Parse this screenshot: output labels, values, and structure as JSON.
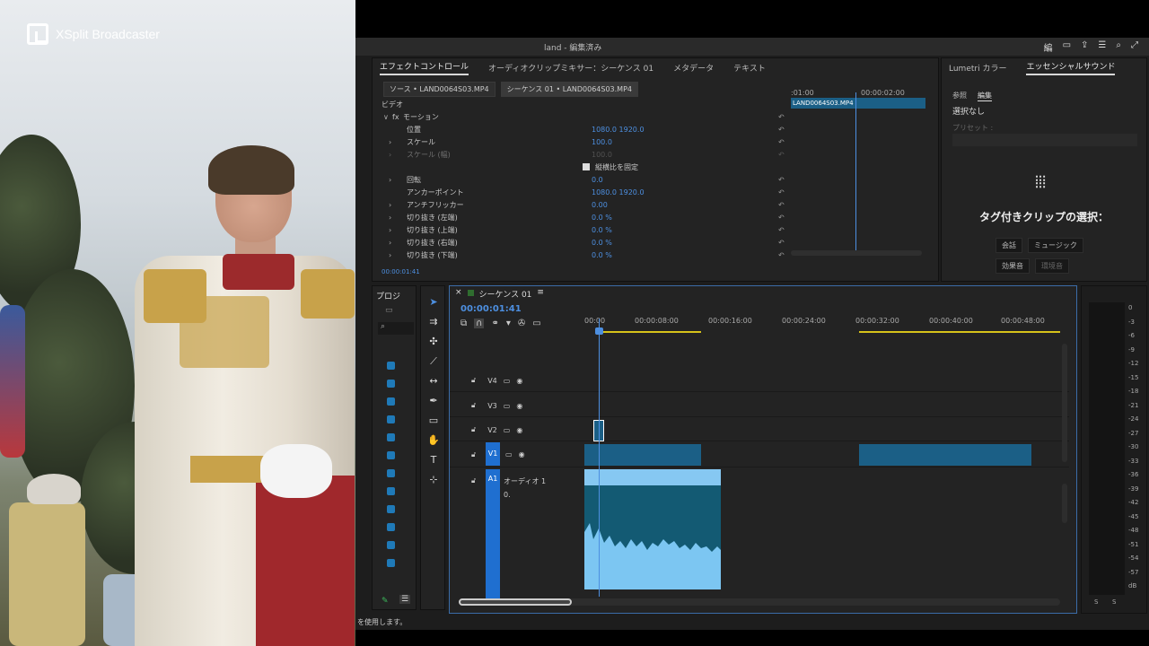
{
  "overlay": {
    "brand": "XSplit Broadcaster"
  },
  "window": {
    "title": "land - 編集済み"
  },
  "effect_panel": {
    "tabs": [
      "エフェクトコントロール",
      "オーディオクリップミキサー：シーケンス 01",
      "メタデータ",
      "テキスト"
    ],
    "source_btn": "ソース • LAND0064S03.MP4",
    "sequence_btn": "シーケンス 01 • LAND0064S03.MP4",
    "section_video": "ビデオ",
    "motion_label": "モーション",
    "rows": [
      {
        "name": "位置",
        "value": "1080.0   1920.0"
      },
      {
        "name": "スケール",
        "value": "100.0"
      },
      {
        "name": "スケール (幅)",
        "value": "100.0"
      },
      {
        "name": "縦横比を固定",
        "value": ""
      },
      {
        "name": "回転",
        "value": "0.0"
      },
      {
        "name": "アンカーポイント",
        "value": "1080.0   1920.0"
      },
      {
        "name": "アンチフリッカー",
        "value": "0.00"
      },
      {
        "name": "切り抜き (左端)",
        "value": "0.0 %"
      },
      {
        "name": "切り抜き (上端)",
        "value": "0.0 %"
      },
      {
        "name": "切り抜き (右端)",
        "value": "0.0 %"
      },
      {
        "name": "切り抜き (下端)",
        "value": "0.0 %"
      }
    ],
    "mini_timeline": {
      "time_left": ":01:00",
      "time_right": "00:00:02:00",
      "clip_name": "LAND0064S03.MP4"
    },
    "timecode": "00:00:01:41"
  },
  "essential_panel": {
    "tabs": [
      "Lumetri カラー",
      "エッセンシャルサウンド"
    ],
    "subtabs": [
      "参照",
      "編集"
    ],
    "no_selection": "選択なし",
    "preset_label": "プリセット :",
    "heading": "タグ付きクリップの選択：",
    "chips": [
      "会話",
      "ミュージック",
      "効果音",
      "環境音"
    ]
  },
  "project_panel": {
    "label": "プロジ"
  },
  "timeline": {
    "name": "シーケンス 01",
    "timecode": "00:00:01:41",
    "ruler": [
      "00:00",
      "00:00:08:00",
      "00:00:16:00",
      "00:00:24:00",
      "00:00:32:00",
      "00:00:40:00",
      "00:00:48:00"
    ],
    "tracks": [
      "V4",
      "V3",
      "V2",
      "V1",
      "A1"
    ],
    "audio_name": "オーディオ 1",
    "audio_vol": "0."
  },
  "meter": {
    "labels": [
      "0",
      "-3",
      "-6",
      "-9",
      "-12",
      "-15",
      "-18",
      "-21",
      "-24",
      "-27",
      "-30",
      "-33",
      "-36",
      "-39",
      "-42",
      "-45",
      "-48",
      "-51",
      "-54",
      "-57",
      "dB"
    ],
    "bottom": [
      "S",
      "S"
    ]
  },
  "status": {
    "text": "を使用します。"
  }
}
